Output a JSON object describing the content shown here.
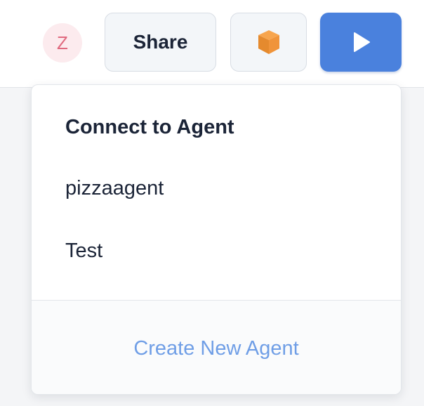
{
  "header": {
    "avatar_initial": "Z",
    "share_label": "Share",
    "cube_icon": "package-cube-icon",
    "run_icon": "play-icon",
    "colors": {
      "run_button": "#4a81dd",
      "avatar_bg": "#fcebee",
      "avatar_text": "#e06a7f",
      "cube_orange": "#f0943a"
    }
  },
  "dropdown": {
    "heading": "Connect to Agent",
    "agents": [
      {
        "label": "pizzaagent"
      },
      {
        "label": "Test"
      }
    ],
    "create_label": "Create New Agent",
    "colors": {
      "link": "#6f9ee6"
    }
  }
}
